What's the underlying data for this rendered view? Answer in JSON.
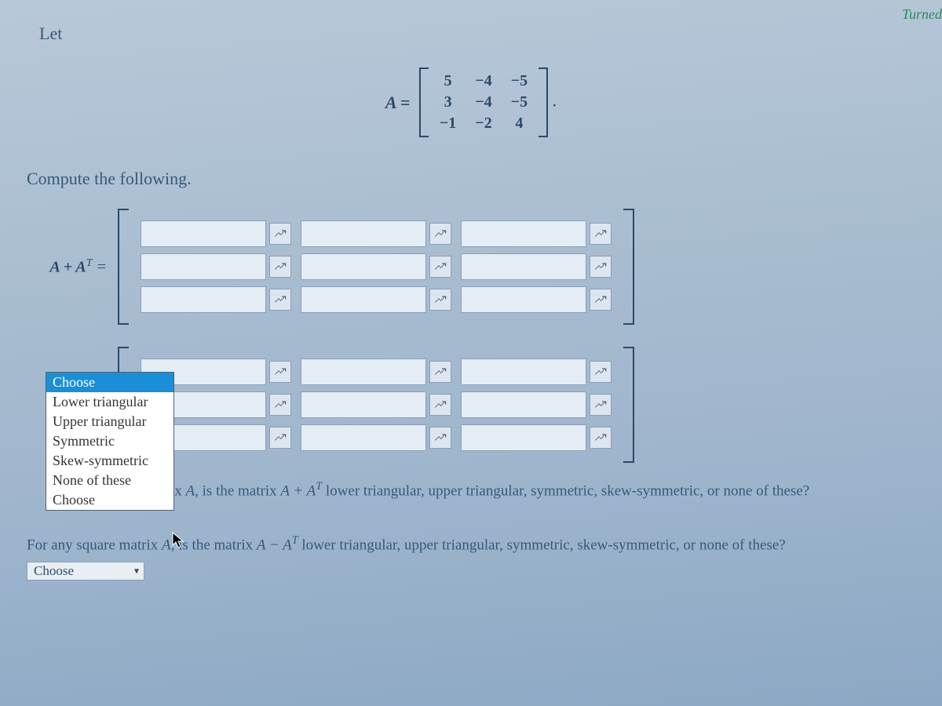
{
  "header": {
    "turned_label": "Turned"
  },
  "intro": {
    "let": "Let",
    "compute": "Compute the following."
  },
  "matrix_def": {
    "label": "A =",
    "rows": [
      [
        "5",
        "−4",
        "−5"
      ],
      [
        "3",
        "−4",
        "−5"
      ],
      [
        "−1",
        "−2",
        "4"
      ]
    ],
    "suffix": "."
  },
  "part1": {
    "label_prefix": "A + A",
    "label_sup": "T",
    "label_suffix": " ="
  },
  "dropdown": {
    "options": [
      "Choose",
      "Lower triangular",
      "Upper triangular",
      "Symmetric",
      "Skew-symmetric",
      "None of these",
      "Choose"
    ],
    "selected_index": 0
  },
  "q1": {
    "visible_prefix": "ix ",
    "A": "A",
    "mid1": ", is the matrix ",
    "expr1": "A + A",
    "sup": "T",
    "tail": " lower triangular, upper triangular, symmetric, skew-symmetric, or none of these?"
  },
  "q2": {
    "prefix": "For any square matrix ",
    "A": "A",
    "mid1": ", is the matrix ",
    "expr1": "A − A",
    "sup": "T",
    "tail": " lower triangular, upper triangular, symmetric, skew-symmetric, or none of these?",
    "select_label": "Choose"
  }
}
